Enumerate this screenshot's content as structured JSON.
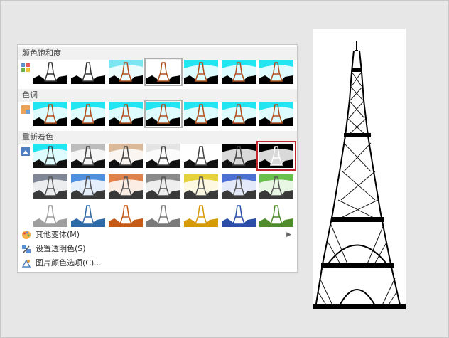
{
  "sections": {
    "saturation": {
      "title": "颜色饱和度"
    },
    "tone": {
      "title": "色调"
    },
    "recolor": {
      "title": "重新着色"
    }
  },
  "colors": {
    "cyan": "#21e6f2",
    "selected_border": "#c1272d",
    "recolor_row2": [
      "#7f8796",
      "#4f8fe0",
      "#e0824a",
      "#8a8a8a",
      "#e6d23c",
      "#4c6fd6",
      "#69c04a"
    ],
    "recolor_row3": [
      "#9e9e9e",
      "#2f6aa8",
      "#c45a16",
      "#7a7a7a",
      "#d69a08",
      "#2a4ea8",
      "#4f8c2b"
    ],
    "recolor_row1": [
      "#21e6f2",
      "#bdbdbd",
      "#d9b99a",
      "#e4e4e4",
      "#ffffff",
      "#000000",
      "#000000"
    ]
  },
  "menu": [
    {
      "label": "其他变体(M)",
      "icon": "palette-icon",
      "has_submenu": true
    },
    {
      "label": "设置透明色(S)",
      "icon": "transparent-color-icon",
      "has_submenu": false
    },
    {
      "label": "图片颜色选项(C)...",
      "icon": "picture-color-options-icon",
      "has_submenu": false
    }
  ]
}
